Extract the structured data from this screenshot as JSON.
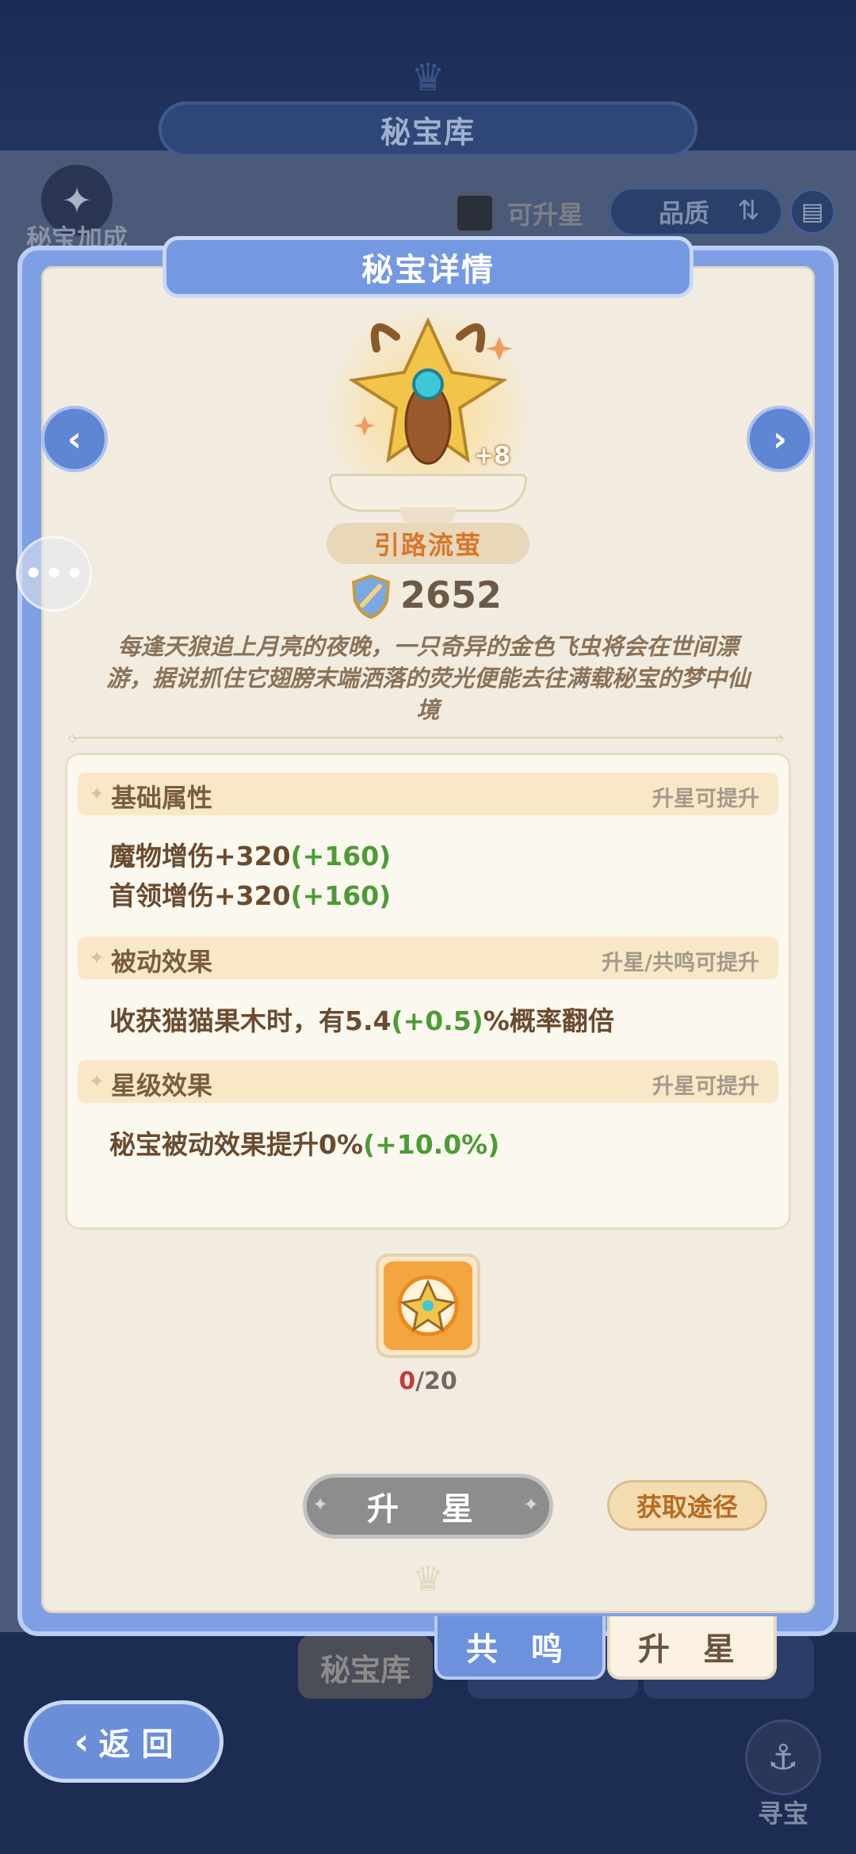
{
  "background": {
    "title": "秘宝库",
    "bonus_label": "秘宝加成",
    "filter_label": "可升星",
    "quality_label": "品质",
    "tab_library": "秘宝库",
    "hunt_label": "寻宝",
    "back_label": "返 回"
  },
  "dialog": {
    "title": "秘宝详情",
    "treasure": {
      "name": "引路流萤",
      "level_badge": "+8",
      "power": "2652",
      "description": "每逢天狼追上月亮的夜晚，一只奇异的金色飞虫将会在世间漂游，据说抓住它翅膀末端洒落的荧光便能去往满载秘宝的梦中仙境"
    },
    "sections": {
      "base": {
        "title": "基础属性",
        "hint": "升星可提升",
        "lines": [
          {
            "text": "魔物增伤+320",
            "bonus": "(+160)"
          },
          {
            "text": "首领增伤+320",
            "bonus": "(+160)"
          }
        ]
      },
      "passive": {
        "title": "被动效果",
        "hint": "升星/共鸣可提升",
        "line_prefix": "收获猫猫果木时，有5.4",
        "line_bonus": "(+0.5)",
        "line_suffix": "%概率翻倍"
      },
      "star": {
        "title": "星级效果",
        "hint": "升星可提升",
        "line_prefix": "秘宝被动效果提升0%",
        "line_bonus": "(+10.0%)"
      }
    },
    "material": {
      "current": "0",
      "required": "/20"
    },
    "buttons": {
      "star_up": "升 星",
      "acquire": "获取途径"
    },
    "tabs": {
      "resonance": "共 鸣",
      "star_up": "升 星"
    }
  },
  "colors": {
    "accent_blue": "#7598e2",
    "bonus_green": "#4d9b36",
    "name_orange": "#d9762a"
  }
}
